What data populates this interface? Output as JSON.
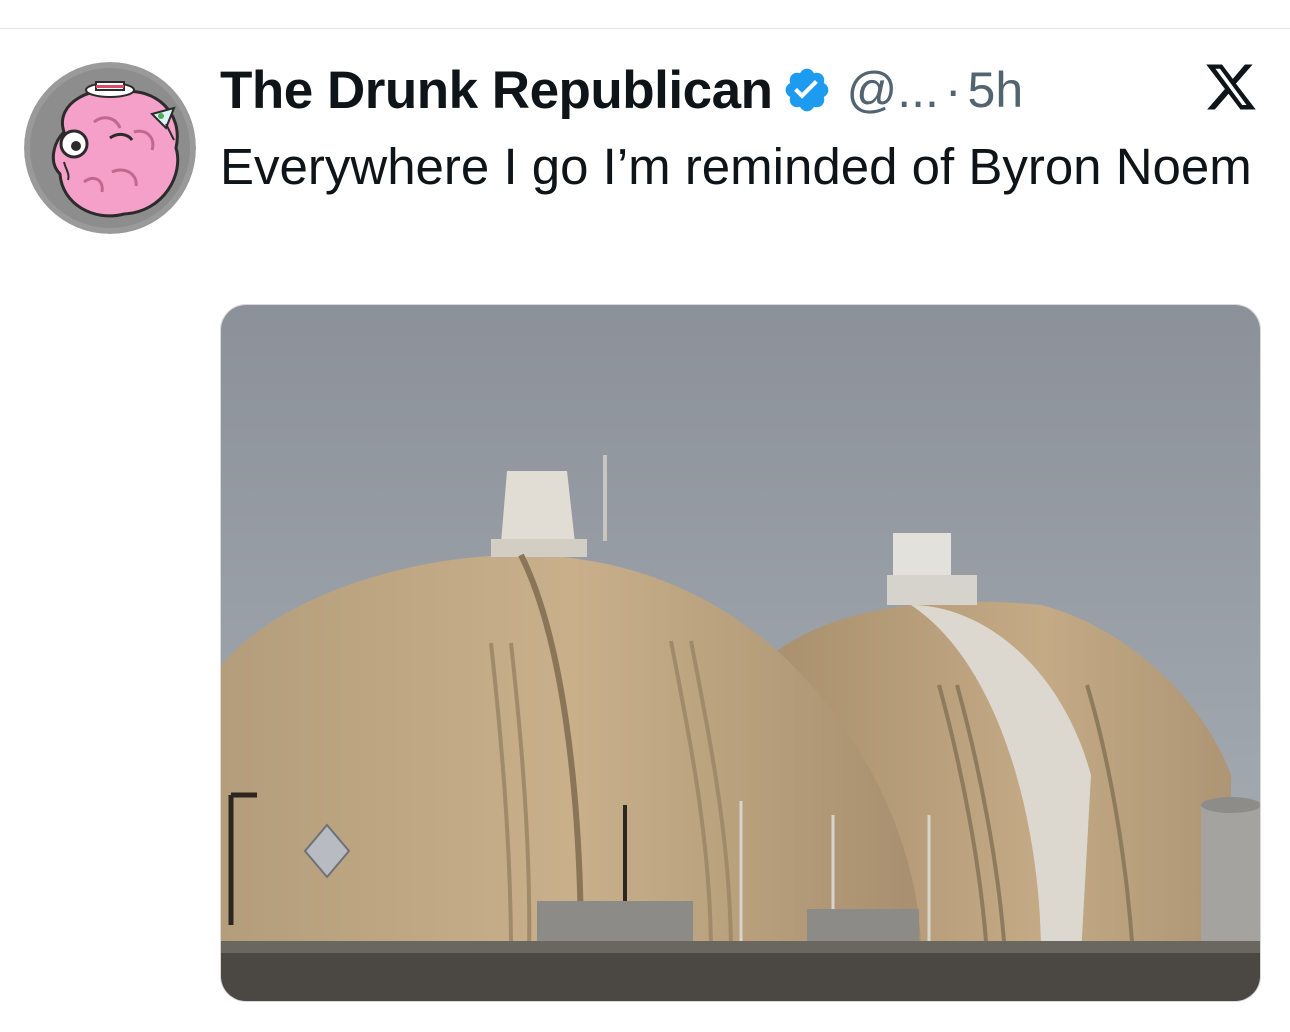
{
  "tweet": {
    "display_name": "The Drunk Republican",
    "handle": "@...",
    "separator": "·",
    "timestamp": "5h",
    "text": "Everywhere I go I’m reminded of Byron Noem"
  },
  "icons": {
    "verified": "verified-badge-icon",
    "platform_logo": "x-logo-icon"
  },
  "colors": {
    "verified_blue": "#1d9bf0",
    "name_text": "#0f1419",
    "secondary_text": "#536471"
  }
}
